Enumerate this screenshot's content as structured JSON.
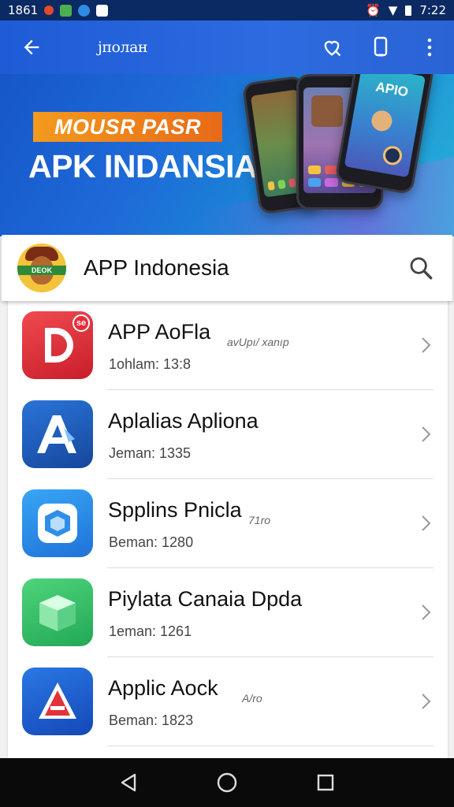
{
  "status_bar": {
    "time_left": "1861",
    "time_right": "7:22"
  },
  "app_bar": {
    "title": "јполан"
  },
  "banner": {
    "tag": "MOUSR PASR",
    "headline": "APK INDANSIA",
    "phone_label": "APIO"
  },
  "search": {
    "title": "APP Indonesia",
    "logo_text": "DEOK"
  },
  "apps": [
    {
      "name": "APP AoFla",
      "meta": "1ohlam: 13:8",
      "note": "avUpı/ xanıp",
      "icon": "letter-d-icon",
      "color": "#e0313a",
      "badge": "se"
    },
    {
      "name": "Aplalias Apliona",
      "meta": "Jeman: 1335",
      "note": "",
      "icon": "letter-a-icon",
      "color": "#1f5fc4"
    },
    {
      "name": "Spplins Pnicla",
      "meta": "Beman: 1280",
      "note": "71ro",
      "icon": "cube-icon",
      "color": "#2f8ee8"
    },
    {
      "name": "Piylata Canaia Dpda",
      "meta": "1eman: 1261",
      "note": "",
      "icon": "box-icon",
      "color": "#34c267"
    },
    {
      "name": "Applic Aock",
      "meta": "Beman: 1823",
      "note": "A/ro",
      "icon": "triangle-a-icon",
      "color": "#1e5fd2"
    }
  ],
  "colors": {
    "primary": "#2d6be0",
    "accent": "#f08a1e"
  }
}
